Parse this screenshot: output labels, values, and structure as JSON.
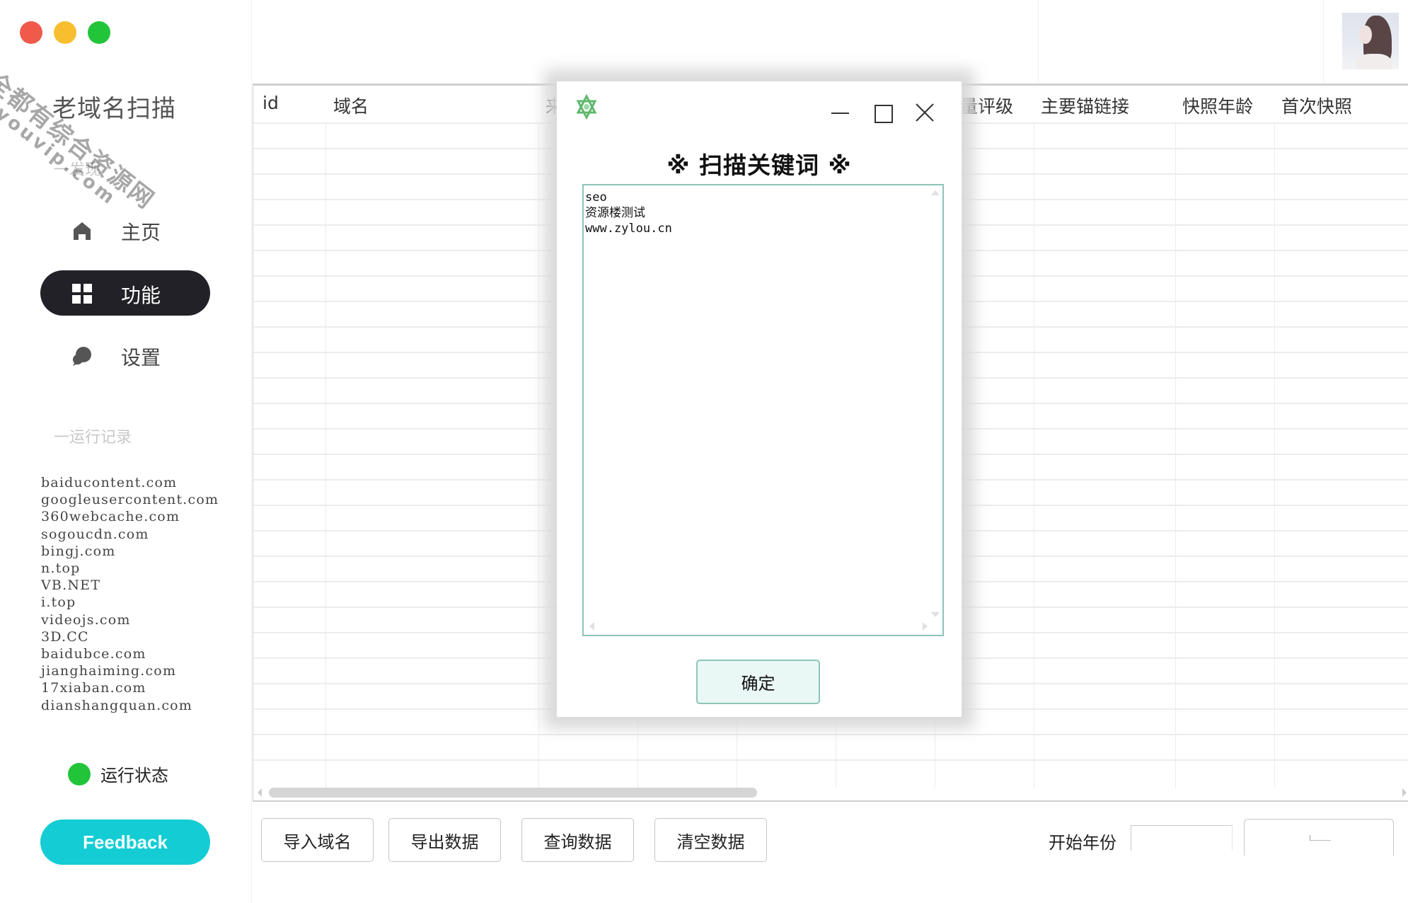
{
  "window": {
    "traffic_lights": [
      "close",
      "minimize",
      "maximize"
    ],
    "colors": {
      "close": "#f05a4b",
      "minimize": "#f7bf2f",
      "maximize": "#22c43a"
    }
  },
  "sidebar": {
    "app_title": "老域名扫描",
    "discover_label": "一发现",
    "nav": [
      {
        "label": "主页",
        "icon": "home-icon",
        "active": false
      },
      {
        "label": "功能",
        "icon": "grid-icon",
        "active": true
      },
      {
        "label": "设置",
        "icon": "chat-bubble-icon",
        "active": false
      }
    ],
    "records_label": "一运行记录",
    "records": [
      "baiducontent.com",
      "googleusercontent.com",
      "360webcache.com",
      "sogoucdn.com",
      "bingj.com",
      "n.top",
      "VB.NET",
      "i.top",
      "videojs.com",
      "3D.CC",
      "baidubce.com",
      "jianghaiming.com",
      "17xiaban.com",
      "dianshangquan.com"
    ],
    "status_label": "运行状态",
    "status_color": "#22c43a",
    "feedback_label": "Feedback",
    "feedback_color": "#14ccd4"
  },
  "table": {
    "columns": [
      "id",
      "域名",
      "来",
      "量评级",
      "主要锚链接",
      "快照年龄",
      "首次快照"
    ],
    "rows": []
  },
  "toolbar": {
    "import_label": "导入域名",
    "export_label": "导出数据",
    "query_label": "查询数据",
    "clear_label": "清空数据",
    "start_year_label": "开始年份",
    "start_year_value": "",
    "end_select_value": ""
  },
  "dialog": {
    "heading": "※ 扫描关键词 ※",
    "keywords": "seo\n资源楼测试\nwww.zylou.cn",
    "ok_label": "确定",
    "accent": "#8cc5b8"
  },
  "watermark": {
    "line1": "全都有综合资源网",
    "line2": "douyouvip.com"
  }
}
